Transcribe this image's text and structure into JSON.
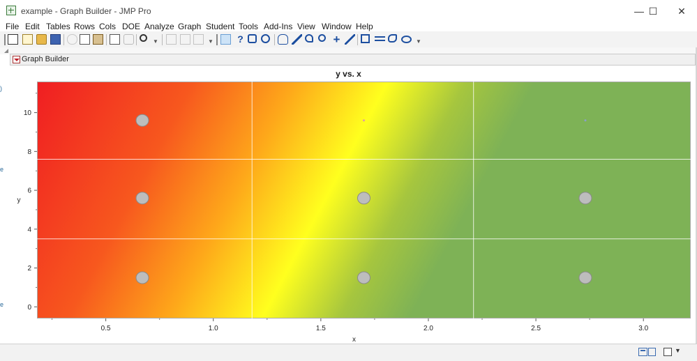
{
  "window": {
    "title": "example - Graph Builder - JMP Pro",
    "minimize_glyph": "—",
    "maximize_glyph": "☐",
    "close_glyph": "✕"
  },
  "menu": [
    "File",
    "Edit",
    "Tables",
    "Rows",
    "Cols",
    "DOE",
    "Analyze",
    "Graph",
    "Student",
    "Tools",
    "Add-Ins",
    "View",
    "Window",
    "Help"
  ],
  "toolbar": {
    "icons": [
      "new-data-table-icon",
      "new-script-icon",
      "open-icon",
      "save-icon",
      "cut-icon",
      "copy-icon",
      "paste-icon",
      "script-icon",
      "lock-icon",
      "search-icon",
      "embed-icon",
      "table-icon",
      "import-icon",
      "arrow-select-icon",
      "help-question-icon",
      "crosshair-icon",
      "target-icon",
      "hand-icon",
      "brush-icon",
      "lasso-icon",
      "zoom-icon",
      "cross-icon",
      "line-icon",
      "text-box-icon",
      "legend-icon",
      "freehand-icon",
      "ellipse-icon"
    ]
  },
  "panel": {
    "title": "Graph Builder"
  },
  "chart_data": {
    "type": "scatter",
    "title": "y vs. x",
    "xlabel": "x",
    "ylabel": "y",
    "xlim": [
      0.18,
      3.22
    ],
    "ylim": [
      -0.6,
      11.6
    ],
    "x_ticks": [
      "0.5",
      "1.0",
      "1.5",
      "2.0",
      "2.5",
      "3.0"
    ],
    "x_tick_values": [
      0.5,
      1.0,
      1.5,
      2.0,
      2.5,
      3.0
    ],
    "y_ticks": [
      "0",
      "2",
      "4",
      "6",
      "8",
      "10"
    ],
    "y_tick_values": [
      0,
      2,
      4,
      6,
      8,
      10
    ],
    "grid": true,
    "vertical_dividers": [
      1.18,
      2.21
    ],
    "horizontal_dividers": [
      3.5,
      7.6
    ],
    "points": [
      {
        "x": 0.67,
        "y": 9.6
      },
      {
        "x": 0.67,
        "y": 5.6
      },
      {
        "x": 0.67,
        "y": 1.5
      },
      {
        "x": 1.7,
        "y": 5.6
      },
      {
        "x": 1.7,
        "y": 1.5
      },
      {
        "x": 2.73,
        "y": 5.6
      },
      {
        "x": 2.73,
        "y": 1.5
      }
    ],
    "marker_points": [
      {
        "x": 1.7,
        "y": 9.6,
        "color": "#e0a0a0"
      },
      {
        "x": 2.73,
        "y": 9.6,
        "color": "#8aa0c8"
      }
    ],
    "point_color": "#bdbdbd",
    "gradient_colors": [
      "#f01e22",
      "#fea81a",
      "#ffff1e",
      "#7eb256"
    ]
  }
}
